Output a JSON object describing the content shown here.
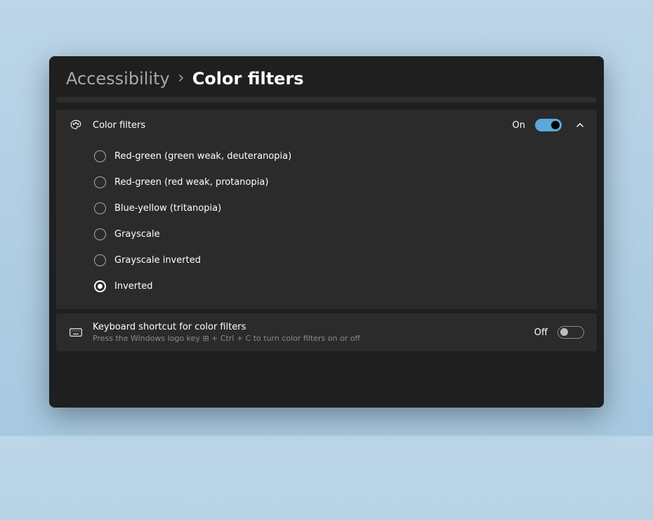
{
  "breadcrumb": {
    "parent": "Accessibility",
    "current": "Color filters"
  },
  "colorFilters": {
    "title": "Color filters",
    "toggleLabel": "On",
    "toggleOn": true,
    "options": [
      {
        "label": "Red-green (green weak, deuteranopia)",
        "selected": false
      },
      {
        "label": "Red-green (red weak, protanopia)",
        "selected": false
      },
      {
        "label": "Blue-yellow (tritanopia)",
        "selected": false
      },
      {
        "label": "Grayscale",
        "selected": false
      },
      {
        "label": "Grayscale inverted",
        "selected": false
      },
      {
        "label": "Inverted",
        "selected": true
      }
    ]
  },
  "keyboardShortcut": {
    "title": "Keyboard shortcut for color filters",
    "description": "Press the Windows logo key ⊞ + Ctrl + C to turn color filters on or off",
    "toggleLabel": "Off",
    "toggleOn": false
  }
}
